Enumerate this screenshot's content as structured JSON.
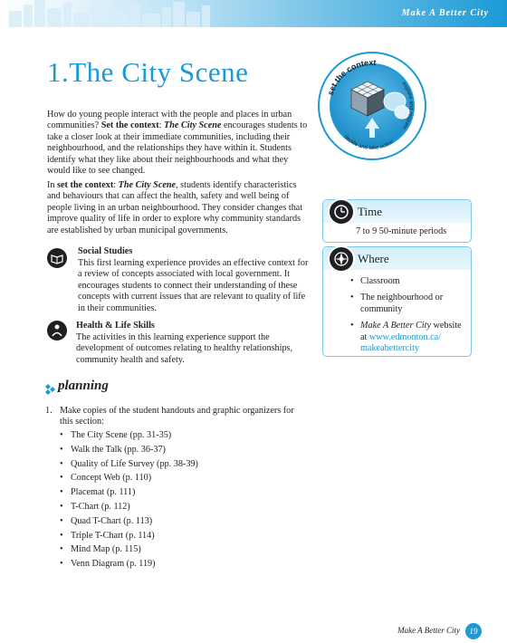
{
  "header": {
    "band_title": "Make A Better City"
  },
  "title": "1.The City Scene",
  "logo": {
    "set_the_context": "set the context",
    "explore": "explore and research",
    "decide": "decide and take action"
  },
  "intro": {
    "p1_a": "How do young people interact with the people and places in urban communities? ",
    "p1_b": "Set the context",
    "p1_c": ": ",
    "p1_d": "The City Scene",
    "p1_e": " encourages students to take a closer look at their immediate communities, including their neighbourhood, and the relationships they have within it. Students identify what they like about their neighbourhoods and what they would like to see changed.",
    "p2_a": "In ",
    "p2_b": "set the context",
    "p2_c": ": ",
    "p2_d": "The City Scene",
    "p2_e": ", students identify characteristics and behaviours that can affect the health, safety and well being of people living in an urban neighbourhood. They consider changes that improve quality of life in order to explore why community standards are established by urban municipal governments."
  },
  "social_studies": {
    "heading": "Social Studies",
    "text": "This first learning experience provides an effective context for a review of concepts associated with local government. It encourages students to connect their understanding of these concepts with current issues that are relevant to quality of life in their communities."
  },
  "health": {
    "heading": "Health & Life Skills",
    "text": "The activities in this learning experience support the development of outcomes relating to healthy relationships, community health and safety."
  },
  "time_box": {
    "title": "Time",
    "body": "7 to 9 50-minute periods"
  },
  "where_box": {
    "title": "Where",
    "items": [
      "Classroom",
      "The neighbourhood or community"
    ],
    "website_title": "Make A Better City",
    "website_pre": " website at ",
    "website_url_1": "www.edmonton.ca/",
    "website_url_2": "makeabettercity"
  },
  "planning": {
    "title": "planning",
    "step_num": "1.",
    "step_text": "Make copies of the student handouts and graphic organizers for this section:",
    "items": [
      "The City Scene (pp. 31-35)",
      "Walk the Talk (pp. 36-37)",
      "Quality of Life Survey (pp. 38-39)",
      "Concept Web (p. 110)",
      "Placemat (p. 111)",
      "T-Chart (p. 112)",
      "Quad T-Chart (p. 113)",
      "Triple T-Chart (p. 114)",
      "Mind Map (p. 115)",
      "Venn Diagram (p. 119)"
    ]
  },
  "footer": {
    "text": "Make A Better City",
    "page": "19"
  }
}
